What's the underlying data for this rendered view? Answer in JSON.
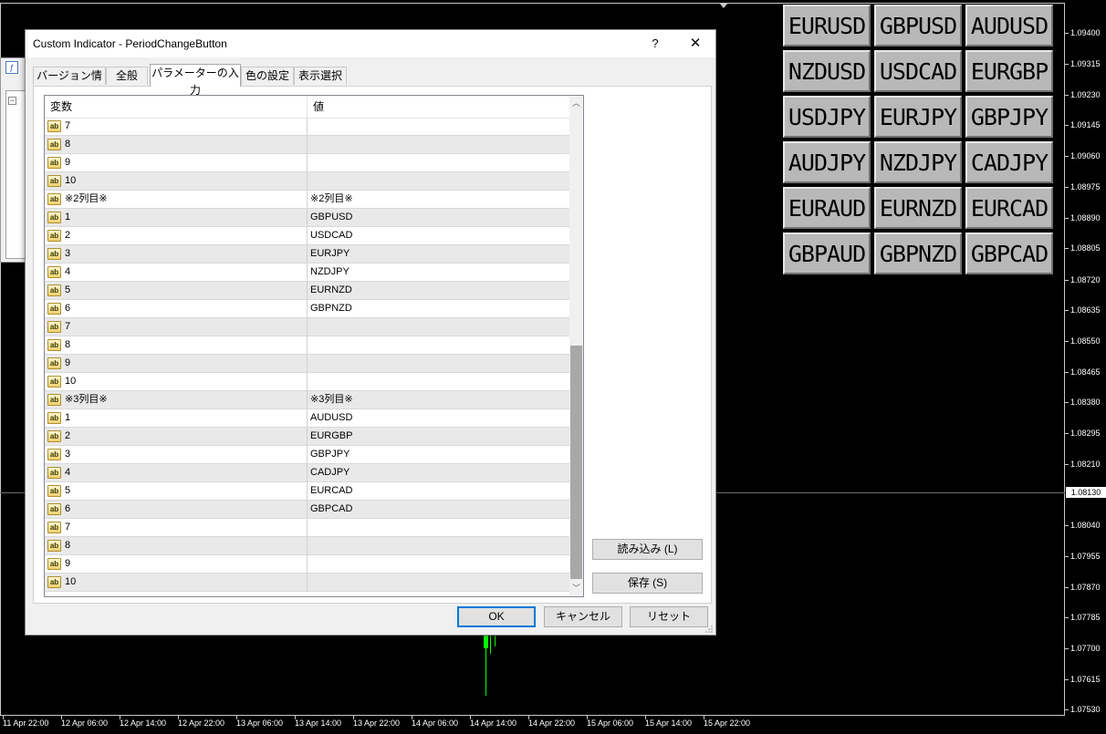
{
  "price_axis": {
    "labels": [
      "1.09400",
      "1.09315",
      "1.09230",
      "1.09145",
      "1.09060",
      "1.08975",
      "1.08890",
      "1.08805",
      "1.08720",
      "1.08635",
      "1.08550",
      "1.08465",
      "1.08380",
      "1.08295",
      "1.08210",
      "1.08040",
      "1.07955",
      "1.07870",
      "1.07785",
      "1.07700",
      "1.07615",
      "1.07530"
    ],
    "current": "1.08130"
  },
  "time_axis": {
    "labels": [
      "11 Apr 22:00",
      "12 Apr 06:00",
      "12 Apr 14:00",
      "12 Apr 22:00",
      "13 Apr 06:00",
      "13 Apr 14:00",
      "13 Apr 22:00",
      "14 Apr 06:00",
      "14 Apr 14:00",
      "14 Apr 22:00",
      "15 Apr 06:00",
      "15 Apr 14:00",
      "15 Apr 22:00"
    ]
  },
  "symbols": [
    [
      "EURUSD",
      "GBPUSD",
      "AUDUSD"
    ],
    [
      "NZDUSD",
      "USDCAD",
      "EURGBP"
    ],
    [
      "USDJPY",
      "EURJPY",
      "GBPJPY"
    ],
    [
      "AUDJPY",
      "NZDJPY",
      "CADJPY"
    ],
    [
      "EURAUD",
      "EURNZD",
      "EURCAD"
    ],
    [
      "GBPAUD",
      "GBPNZD",
      "GBPCAD"
    ]
  ],
  "dialog": {
    "title": "Custom Indicator - PeriodChangeButton",
    "help": "?",
    "close": "✕",
    "tabs": [
      "バージョン情報",
      "全般",
      "パラメーターの入力",
      "色の設定",
      "表示選択"
    ],
    "active_tab": 2,
    "grid": {
      "col_variable": "変数",
      "col_value": "値",
      "rows": [
        {
          "name": "7",
          "value": ""
        },
        {
          "name": "8",
          "value": ""
        },
        {
          "name": "9",
          "value": ""
        },
        {
          "name": "10",
          "value": ""
        },
        {
          "name": "※2列目※",
          "value": "※2列目※"
        },
        {
          "name": "1",
          "value": "GBPUSD"
        },
        {
          "name": "2",
          "value": "USDCAD"
        },
        {
          "name": "3",
          "value": "EURJPY"
        },
        {
          "name": "4",
          "value": "NZDJPY"
        },
        {
          "name": "5",
          "value": "EURNZD"
        },
        {
          "name": "6",
          "value": "GBPNZD"
        },
        {
          "name": "7",
          "value": ""
        },
        {
          "name": "8",
          "value": ""
        },
        {
          "name": "9",
          "value": ""
        },
        {
          "name": "10",
          "value": ""
        },
        {
          "name": "※3列目※",
          "value": "※3列目※"
        },
        {
          "name": "1",
          "value": "AUDUSD"
        },
        {
          "name": "2",
          "value": "EURGBP"
        },
        {
          "name": "3",
          "value": "GBPJPY"
        },
        {
          "name": "4",
          "value": "CADJPY"
        },
        {
          "name": "5",
          "value": "EURCAD"
        },
        {
          "name": "6",
          "value": "GBPCAD"
        },
        {
          "name": "7",
          "value": ""
        },
        {
          "name": "8",
          "value": ""
        },
        {
          "name": "9",
          "value": ""
        },
        {
          "name": "10",
          "value": ""
        }
      ]
    },
    "buttons": {
      "load": "読み込み (L)",
      "save": "保存 (S)",
      "ok": "OK",
      "cancel": "キャンセル",
      "reset": "リセット"
    }
  },
  "colors": {
    "candle": "#00ff00",
    "accent": "#0078d7",
    "chart_bg": "#000000"
  }
}
